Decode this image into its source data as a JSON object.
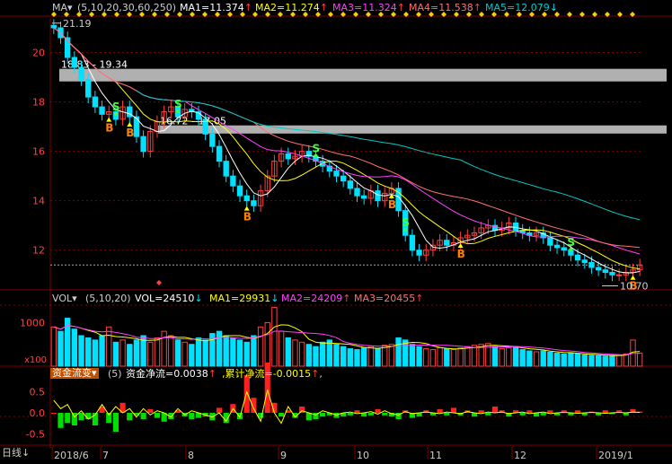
{
  "main_header": {
    "ma_label": "MA▾",
    "params": "(5,10,20,30,60,250)",
    "ma1": "MA1=11.374",
    "ma2": "MA2=11.274",
    "ma3": "MA3=11.324",
    "ma4": "MA4=11.538",
    "ma5": "MA5=12.079",
    "arrow_up": "↑",
    "arrow_down": "↓"
  },
  "vol_header": {
    "label": "VOL▾",
    "params": "(5,10,20)",
    "vol": "VOL=24510",
    "ma1": "MA1=29931",
    "ma2": "MA2=24209",
    "ma3": "MA3=20455",
    "arrow_down": "↓",
    "arrow_up": "↑"
  },
  "flow_header": {
    "label": "资金流变▾",
    "params": "(5)",
    "net": "资金净流=0.0038",
    "arrow_up": "↑",
    "cum": "累计净流=-0.0015",
    "arrow_up2": "↑",
    "comma": ","
  },
  "bottom": {
    "period": "日线",
    "period_icon": "↓"
  },
  "colors": {
    "up": "#ff4040",
    "down": "#00e0ff",
    "ma1": "#ffffff",
    "ma2": "#ffff00",
    "ma3": "#ff40ff",
    "ma4": "#ff7070",
    "ma5": "#00c8c8",
    "band": "#b0b0b0",
    "grid": "#800000"
  },
  "chart_data": {
    "type": "candlestick",
    "x_labels": [
      "2018/6",
      "7",
      "8",
      "9",
      "10",
      "11",
      "12",
      "2019/1"
    ],
    "y_ticks": [
      12,
      14,
      16,
      18,
      20
    ],
    "ylim": [
      10.5,
      21.4
    ],
    "annotations": {
      "high": "21.19",
      "low": "10.70",
      "band1": "18.83 - 19.34",
      "band2": "16.72 - 17.05"
    },
    "band1": [
      18.83,
      19.34
    ],
    "band2": [
      16.72,
      17.05
    ],
    "closes": [
      21.0,
      20.6,
      19.8,
      19.4,
      18.9,
      18.2,
      17.8,
      17.5,
      17.6,
      17.3,
      17.8,
      17.4,
      16.6,
      16.0,
      16.8,
      17.2,
      17.6,
      17.8,
      17.4,
      17.7,
      17.6,
      17.3,
      16.7,
      16.2,
      15.6,
      15.0,
      14.6,
      14.2,
      14.0,
      13.8,
      14.4,
      15.0,
      15.6,
      15.9,
      15.7,
      15.8,
      16.0,
      15.8,
      15.6,
      15.4,
      15.2,
      15.0,
      14.8,
      14.5,
      14.2,
      14.1,
      14.4,
      14.0,
      14.3,
      14.5,
      13.6,
      12.6,
      12.0,
      11.8,
      12.0,
      12.2,
      12.4,
      12.2,
      12.3,
      12.5,
      12.6,
      12.7,
      12.9,
      13.0,
      12.8,
      12.9,
      13.1,
      12.8,
      12.7,
      12.6,
      12.7,
      12.5,
      12.2,
      12.1,
      12.0,
      11.8,
      11.6,
      11.5,
      11.3,
      11.2,
      11.1,
      11.0,
      11.0,
      11.1,
      11.2,
      11.4
    ],
    "buy_signals": [
      8,
      11,
      28,
      49,
      59,
      84
    ],
    "sell_signals": [
      9,
      18,
      38,
      51,
      75
    ],
    "volume_ylim": [
      0,
      1400
    ],
    "volume_ticks": [
      1000
    ],
    "volume_unit": "x100",
    "volume": [
      900,
      800,
      1100,
      850,
      700,
      650,
      600,
      700,
      900,
      550,
      600,
      500,
      600,
      700,
      550,
      650,
      800,
      700,
      600,
      550,
      500,
      650,
      600,
      750,
      800,
      700,
      650,
      600,
      550,
      700,
      900,
      1000,
      1350,
      800,
      650,
      600,
      550,
      500,
      450,
      550,
      600,
      500,
      450,
      400,
      380,
      420,
      450,
      400,
      480,
      500,
      650,
      600,
      500,
      450,
      400,
      380,
      420,
      400,
      380,
      420,
      450,
      480,
      500,
      520,
      450,
      400,
      420,
      450,
      380,
      350,
      330,
      350,
      320,
      300,
      280,
      300,
      280,
      260,
      250,
      240,
      230,
      250,
      260,
      280,
      600,
      300
    ],
    "flow_ylim": [
      -0.75,
      0.75
    ],
    "flow_ticks": [
      0.5,
      0.0,
      -0.5
    ],
    "flow": [
      0,
      -0.12,
      -0.08,
      -0.1,
      -0.06,
      -0.05,
      -0.1,
      0.05,
      -0.08,
      -0.15,
      0.08,
      -0.06,
      -0.02,
      -0.05,
      0.03,
      -0.04,
      -0.07,
      -0.05,
      0.02,
      -0.03,
      -0.05,
      -0.04,
      -0.03,
      -0.06,
      0.04,
      -0.08,
      0.07,
      -0.05,
      0.3,
      0.12,
      -0.04,
      0.4,
      0.08,
      -0.03,
      0.02,
      -0.04,
      0.05,
      -0.06,
      -0.05,
      -0.03,
      -0.02,
      -0.04,
      -0.03,
      -0.02,
      0.02,
      -0.03,
      -0.02,
      0.03,
      -0.02,
      -0.03,
      -0.05,
      0.02,
      -0.04,
      -0.03,
      0.02,
      -0.02,
      0.03,
      -0.02,
      0.04,
      -0.02,
      0.02,
      -0.03,
      0.02,
      -0.02,
      0.05,
      0.02,
      -0.03,
      0.02,
      -0.02,
      0.02,
      -0.03,
      -0.02,
      0.02,
      -0.02,
      0.02,
      -0.02,
      0.02,
      -0.02,
      0.01,
      -0.02,
      0.02,
      -0.01,
      0.02,
      -0.02,
      0.03,
      0.01
    ],
    "flow_line": [
      0.3,
      0.1,
      0.2,
      -0.1,
      0.05,
      -0.15,
      -0.05,
      0.2,
      -0.05,
      0.15,
      0.0,
      0.1,
      -0.1,
      0.1,
      -0.05,
      0.05,
      0.0,
      -0.1,
      0.1,
      -0.05,
      0.05,
      0.0,
      -0.05,
      -0.1,
      0.0,
      -0.2,
      0.1,
      -0.1,
      0.5,
      0.1,
      -0.2,
      0.55,
      0.0,
      -0.25,
      0.15,
      -0.1,
      0.05,
      0.0,
      -0.05,
      0.05,
      0.0,
      -0.05,
      0.0,
      0.02,
      -0.02,
      0.0,
      0.03,
      -0.03,
      0.05,
      -0.02,
      -0.05,
      0.03,
      -0.02,
      0.0,
      0.02,
      0.0,
      -0.02,
      0.02,
      0.0,
      -0.02,
      0.03,
      0.0,
      -0.02,
      0.02,
      0.0,
      0.02,
      -0.02,
      0.0,
      0.02,
      -0.02,
      0.0,
      0.02,
      -0.02,
      0.0,
      0.01,
      0.0,
      -0.01,
      0.0,
      0.01,
      0.0,
      -0.01,
      0.0,
      0.01,
      0.0,
      0.02,
      0.01
    ]
  }
}
